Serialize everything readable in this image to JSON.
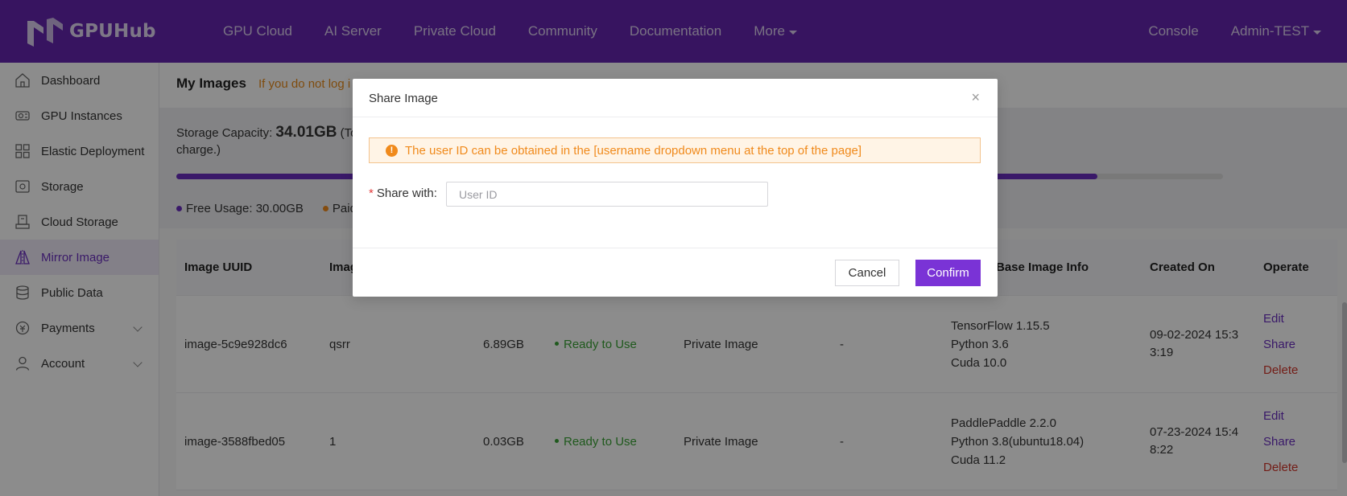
{
  "brand": {
    "name": "GPUHub"
  },
  "nav": {
    "items": [
      "GPU Cloud",
      "AI Server",
      "Private Cloud",
      "Community",
      "Documentation",
      "More"
    ],
    "console": "Console",
    "user": "Admin-TEST"
  },
  "sidebar": {
    "items": [
      {
        "label": "Dashboard",
        "icon": "home-icon"
      },
      {
        "label": "GPU Instances",
        "icon": "gpu-icon"
      },
      {
        "label": "Elastic Deployment",
        "icon": "grid-icon"
      },
      {
        "label": "Storage",
        "icon": "storage-icon"
      },
      {
        "label": "Cloud Storage",
        "icon": "cloud-storage-icon"
      },
      {
        "label": "Mirror Image",
        "icon": "mirror-icon",
        "active": true
      },
      {
        "label": "Public Data",
        "icon": "database-icon"
      },
      {
        "label": "Payments",
        "icon": "payments-icon",
        "expandable": true
      },
      {
        "label": "Account",
        "icon": "account-icon",
        "expandable": true
      }
    ]
  },
  "page": {
    "title": "My Images",
    "note": "If you do not log i"
  },
  "storage": {
    "label": "Storage Capacity:",
    "value": "34.01GB",
    "suffix": "(To",
    "line2": "charge.)",
    "legend_free": "Free Usage: 30.00GB",
    "legend_paid": "Paid"
  },
  "table": {
    "headers": [
      "Image UUID",
      "Imag",
      "Base Image Info",
      "Created On",
      "Operate"
    ],
    "rows": [
      {
        "uuid": "image-5c9e928dc6",
        "name": "qsrr",
        "size": "6.89GB",
        "status": "Ready to Use",
        "type": "Private Image",
        "shared": "-",
        "base": [
          "TensorFlow  1.15.5",
          "Python  3.6",
          "Cuda  10.0"
        ],
        "created": [
          "09-02-2024 15:3",
          "3:19"
        ],
        "ops": [
          "Edit",
          "Share",
          "Delete"
        ]
      },
      {
        "uuid": "image-3588fbed05",
        "name": "1",
        "size": "0.03GB",
        "status": "Ready to Use",
        "type": "Private Image",
        "shared": "-",
        "base": [
          "PaddlePaddle  2.2.0",
          "Python  3.8(ubuntu18.04)",
          "Cuda  11.2"
        ],
        "created": [
          "07-23-2024 15:4",
          "8:22"
        ],
        "ops": [
          "Edit",
          "Share",
          "Delete"
        ]
      }
    ]
  },
  "modal": {
    "title": "Share Image",
    "close": "×",
    "alert_icon": "!",
    "alert": "The user ID can be obtained in the [username dropdown menu at the top of the page]",
    "required_mark": "*",
    "share_label": "Share with:",
    "input_placeholder": "User ID",
    "input_value": "",
    "cancel": "Cancel",
    "confirm": "Confirm"
  },
  "colors": {
    "brand": "#6526b0",
    "accent": "#7a33d6",
    "warning": "#f08a1c",
    "success": "#3aa335",
    "danger": "#d2362a"
  }
}
